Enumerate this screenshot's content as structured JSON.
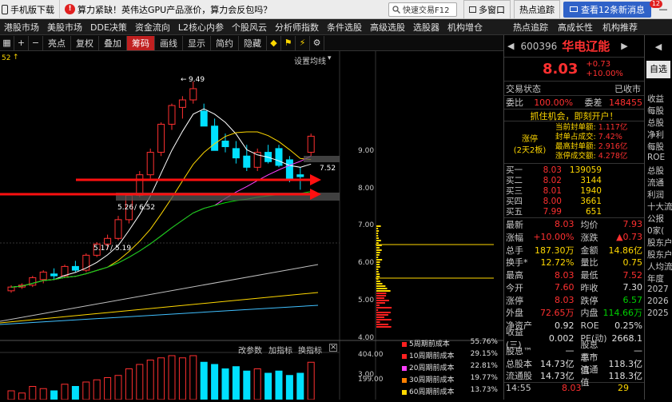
{
  "topbar": {
    "mobile_download": "手机版下载",
    "news": "算力紧缺！英伟达GPU产品涨价，算力会反包吗？",
    "search_placeholder": "快速交易F12",
    "account": "多窗口",
    "hot_tracking": "热点追踪",
    "message": "查看12条新消息",
    "message_count": "12",
    "minimize": "—"
  },
  "menubar": {
    "items": [
      "港股市场",
      "美股市场",
      "DDE决策",
      "资金流向",
      "L2核心内参",
      "个股风云",
      "分析师指数",
      "条件选股",
      "高级选股",
      "选股器",
      "机构增仓"
    ],
    "right_items": [
      "热点追踪",
      "高成长性",
      "机构推荐"
    ]
  },
  "toolbar": {
    "items": [
      "亮点",
      "复权",
      "叠加",
      "筹码",
      "画线",
      "显示",
      "简约",
      "隐藏"
    ],
    "active": "筹码"
  },
  "chart": {
    "price_label_left": "52",
    "settings": "设置均线",
    "high_label": "9.49",
    "label_526": "5.26",
    "label_652": "6.52",
    "label_517": "5.17",
    "label_519": "5.19",
    "label_752": "7.52",
    "yaxis": [
      "9.00",
      "8.00",
      "7.00",
      "6.00",
      "5.00",
      "4.00",
      "3.00"
    ],
    "vol_axis": [
      "404.00",
      "199.00"
    ],
    "sub_toolbar": [
      "改参数",
      "加指标",
      "换指标"
    ],
    "chip_legend": [
      {
        "label": "5周期前成本",
        "pct": "55.76%",
        "color": "#ff2020"
      },
      {
        "label": "10周期前成本",
        "pct": "29.15%",
        "color": "#ff2020"
      },
      {
        "label": "20周期前成本",
        "pct": "22.81%",
        "color": "#ff40ff"
      },
      {
        "label": "30周期前成本",
        "pct": "19.77%",
        "color": "#ff8000"
      },
      {
        "label": "60周期前成本",
        "pct": "13.73%",
        "color": "#ffd800"
      }
    ],
    "ohlc_candles": [
      {
        "o": 3.9,
        "h": 4.05,
        "l": 3.85,
        "c": 4.0
      },
      {
        "o": 4.0,
        "h": 4.1,
        "l": 3.95,
        "c": 4.05
      },
      {
        "o": 4.05,
        "h": 4.3,
        "l": 4.0,
        "c": 4.25
      },
      {
        "o": 4.2,
        "h": 4.45,
        "l": 4.1,
        "c": 4.4
      },
      {
        "o": 4.35,
        "h": 4.5,
        "l": 4.2,
        "c": 4.3
      },
      {
        "o": 4.3,
        "h": 4.6,
        "l": 4.25,
        "c": 4.55
      },
      {
        "o": 4.55,
        "h": 4.7,
        "l": 4.4,
        "c": 4.45
      },
      {
        "o": 4.45,
        "h": 4.9,
        "l": 4.4,
        "c": 4.85
      },
      {
        "o": 4.85,
        "h": 5.2,
        "l": 4.8,
        "c": 5.15
      },
      {
        "o": 5.15,
        "h": 5.4,
        "l": 5.0,
        "c": 5.3
      },
      {
        "o": 5.3,
        "h": 5.9,
        "l": 5.25,
        "c": 5.8
      },
      {
        "o": 5.8,
        "h": 6.5,
        "l": 5.7,
        "c": 6.45
      },
      {
        "o": 6.45,
        "h": 7.1,
        "l": 6.4,
        "c": 7.0
      },
      {
        "o": 7.0,
        "h": 7.7,
        "l": 6.9,
        "c": 7.6
      },
      {
        "o": 7.6,
        "h": 8.4,
        "l": 7.5,
        "c": 8.35
      },
      {
        "o": 8.35,
        "h": 8.9,
        "l": 8.2,
        "c": 8.85
      },
      {
        "o": 8.8,
        "h": 9.1,
        "l": 8.5,
        "c": 9.0
      },
      {
        "o": 9.0,
        "h": 9.49,
        "l": 8.9,
        "c": 9.3
      },
      {
        "o": 8.7,
        "h": 8.9,
        "l": 8.3,
        "c": 8.3
      },
      {
        "o": 8.3,
        "h": 8.5,
        "l": 7.7,
        "c": 7.65
      },
      {
        "o": 7.9,
        "h": 8.1,
        "l": 7.6,
        "c": 7.75
      },
      {
        "o": 7.7,
        "h": 7.9,
        "l": 7.3,
        "c": 7.45
      },
      {
        "o": 7.5,
        "h": 7.8,
        "l": 7.1,
        "c": 7.2
      },
      {
        "o": 7.2,
        "h": 7.7,
        "l": 7.1,
        "c": 7.6
      },
      {
        "o": 7.6,
        "h": 7.8,
        "l": 7.3,
        "c": 7.35
      },
      {
        "o": 7.7,
        "h": 7.8,
        "l": 7.2,
        "c": 7.25
      },
      {
        "o": 7.4,
        "h": 7.5,
        "l": 6.8,
        "c": 6.85
      },
      {
        "o": 7.0,
        "h": 7.2,
        "l": 6.6,
        "c": 6.95
      },
      {
        "o": 7.6,
        "h": 8.1,
        "l": 7.5,
        "c": 8.03
      }
    ]
  },
  "quote": {
    "code": "600396",
    "name": "华电辽能",
    "price": "8.03",
    "change": "+0.73",
    "change_pct": "+10.00%",
    "trade_status_label": "交易状态",
    "trade_status": "已收市",
    "weibi_label": "委比",
    "weibi": "100.00%",
    "weicha_label": "委差",
    "weicha": "148455",
    "banner": "抓住机会，即刻开户！",
    "seal_title": "涨停",
    "seal_sub": "(2天2板)",
    "seal_rows": [
      {
        "k": "当前封单额:",
        "v": "1.117亿"
      },
      {
        "k": "封单占成交:",
        "v": "7.42%"
      },
      {
        "k": "最高封单额:",
        "v": "2.916亿"
      },
      {
        "k": "涨停成交额:",
        "v": "4.278亿"
      }
    ],
    "orderbook": [
      {
        "k": "买一",
        "p": "8.03",
        "v": "139059"
      },
      {
        "k": "买二",
        "p": "8.02",
        "v": "3144"
      },
      {
        "k": "买三",
        "p": "8.01",
        "v": "1940"
      },
      {
        "k": "买四",
        "p": "8.00",
        "v": "3661"
      },
      {
        "k": "买五",
        "p": "7.99",
        "v": "651"
      }
    ],
    "stats": [
      {
        "a": "最新",
        "b": "8.03",
        "bc": "red",
        "c": "均价",
        "d": "7.93",
        "dc": "red"
      },
      {
        "a": "涨幅",
        "b": "+10.00%",
        "bc": "red",
        "c": "涨跌",
        "d": "▲0.73",
        "dc": "red"
      },
      {
        "a": "总手",
        "b": "187.30万",
        "bc": "yellow",
        "c": "金额",
        "d": "14.86亿",
        "dc": "yellow"
      },
      {
        "a": "换手*",
        "b": "12.72%",
        "bc": "yellow",
        "c": "量比",
        "d": "0.75",
        "dc": "yellow"
      },
      {
        "a": "最高",
        "b": "8.03",
        "bc": "red",
        "c": "最低",
        "d": "7.52",
        "dc": "red"
      },
      {
        "a": "今开",
        "b": "7.60",
        "bc": "red",
        "c": "昨收",
        "d": "7.30",
        "dc": "white"
      },
      {
        "a": "涨停",
        "b": "8.03",
        "bc": "red",
        "c": "跌停",
        "d": "6.57",
        "dc": "green"
      },
      {
        "a": "外盘",
        "b": "72.65万",
        "bc": "red",
        "c": "内盘",
        "d": "114.66万",
        "dc": "green"
      },
      {
        "a": "净资产",
        "b": "0.92",
        "bc": "white",
        "c": "ROE",
        "d": "0.25%",
        "dc": "white"
      },
      {
        "a": "收益(三)",
        "b": "0.002",
        "bc": "white",
        "c": "PE(动)",
        "d": "2668.1",
        "dc": "white"
      },
      {
        "a": "股息™",
        "b": "—",
        "bc": "white",
        "c": "股息率™",
        "d": "—",
        "dc": "white"
      },
      {
        "a": "总股本",
        "b": "14.73亿",
        "bc": "white",
        "c": "总市值",
        "d": "118.3亿",
        "dc": "white"
      },
      {
        "a": "流通股",
        "b": "14.73亿",
        "bc": "white",
        "c": "流通值",
        "d": "118.3亿",
        "dc": "white"
      }
    ],
    "last_row": {
      "t": "14:55",
      "p": "8.03",
      "v": "29"
    }
  },
  "side": {
    "select": "自选",
    "items": [
      "收益",
      "每股",
      "总股",
      "净利",
      "每股",
      "ROE",
      "总股",
      "流通",
      "利润",
      "十大流",
      "公报",
      "0家(",
      "股东户",
      "股东户",
      "人均流",
      "年度",
      "2027",
      "2026",
      "2025"
    ]
  }
}
